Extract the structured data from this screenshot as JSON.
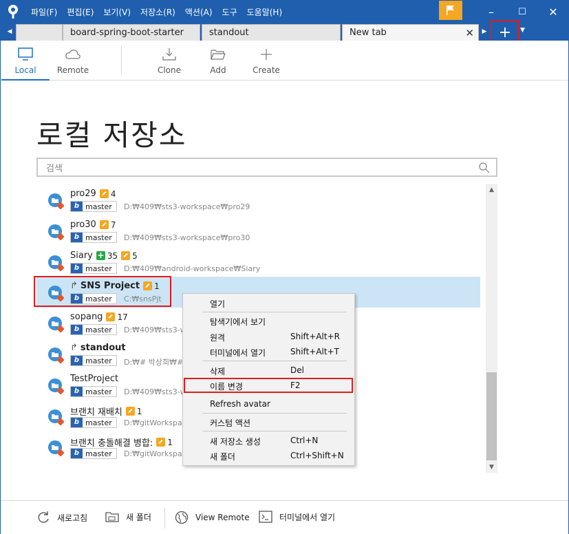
{
  "menu": [
    "파일(F)",
    "편집(E)",
    "보기(V)",
    "저장소(R)",
    "액션(A)",
    "도구",
    "도움말(H)"
  ],
  "window_controls": {
    "minimize": "–",
    "maximize": "☐",
    "close": "✕"
  },
  "tabs": [
    {
      "label": ""
    },
    {
      "label": "board-spring-boot-starter"
    },
    {
      "label": "standout"
    },
    {
      "label": "New tab",
      "close": "✕"
    }
  ],
  "newtab_label": "+",
  "toolbar": {
    "local": "Local",
    "remote": "Remote",
    "clone": "Clone",
    "add": "Add",
    "create": "Create"
  },
  "page_title": "로컬 저장소",
  "search": {
    "placeholder": "검색"
  },
  "repos": [
    {
      "name": "pro29",
      "edit_count": "4",
      "branch": "master",
      "path": "D:₩409₩sts3-workspace₩pro29"
    },
    {
      "name": "pro30",
      "edit_count": "7",
      "branch": "master",
      "path": "D:₩409₩sts3-workspace₩pro30"
    },
    {
      "name": "Siary",
      "add_count": "35",
      "edit_count": "5",
      "branch": "master",
      "path": "D:₩409₩android-workspace₩Siary"
    },
    {
      "name": "SNS Project",
      "edit_count": "1",
      "branch": "master",
      "path": "C:₩snsPjt"
    },
    {
      "name": "sopang",
      "edit_count": "17",
      "branch": "master",
      "path": "D:₩409₩sts3-wo"
    },
    {
      "name": "standout",
      "branch": "master",
      "path": "D:₩# 박상희₩#."
    },
    {
      "name": "TestProject",
      "branch": "master",
      "path": "D:₩409₩sts3-wo"
    },
    {
      "name": "브랜치 재배치",
      "edit_count": "1",
      "branch": "master",
      "path": "D:₩gitWorkspac"
    },
    {
      "name": "브랜치 충돌해결 병합:",
      "edit_count": "1",
      "branch": "master",
      "path": "D:₩gitWorkspac"
    }
  ],
  "context_menu": {
    "open": "열기",
    "show_in_explorer": "탐색기에서 보기",
    "remote": "원격",
    "remote_shortcut": "Shift+Alt+R",
    "open_in_terminal": "터미널에서 열기",
    "open_in_terminal_shortcut": "Shift+Alt+T",
    "delete": "삭제",
    "delete_shortcut": "Del",
    "rename": "이름 변경",
    "rename_shortcut": "F2",
    "refresh_avatar": "Refresh avatar",
    "custom_actions": "커스텀 액션",
    "new_repo": "새 저장소 생성",
    "new_repo_shortcut": "Ctrl+N",
    "new_folder": "새 폴더",
    "new_folder_shortcut": "Ctrl+Shift+N"
  },
  "bottombar": {
    "refresh": "새로고침",
    "new_folder": "새 폴더",
    "view_remote": "View Remote",
    "open_terminal": "터미널에서 열기"
  },
  "colors": {
    "titlebar": "#1f5fae",
    "accent": "#1f6fc4",
    "selection": "#cce5f6",
    "highlight": "#e41b1b",
    "flag": "#f5a623"
  }
}
